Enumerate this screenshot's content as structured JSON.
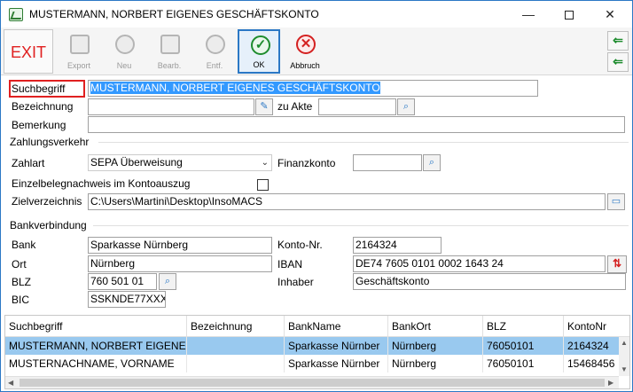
{
  "window": {
    "title": "MUSTERMANN, NORBERT EIGENES GESCHÄFTSKONTO",
    "minimize": "—",
    "close": "✕"
  },
  "toolbar": {
    "exit": "EXIT",
    "export": "Export",
    "neu": "Neu",
    "bearb": "Bearb.",
    "entf": "Entf.",
    "ok": "OK",
    "abbruch": "Abbruch",
    "ok_glyph": "✓",
    "cancel_glyph": "✕",
    "side_first": "⇐",
    "side_second": "⇐"
  },
  "form": {
    "suchbegriff_label": "Suchbegriff",
    "suchbegriff_value": "MUSTERMANN, NORBERT EIGENES GESCHÄFTSKONTO",
    "bezeichnung_label": "Bezeichnung",
    "bezeichnung_value": "",
    "zu_akte_label": "zu Akte",
    "zu_akte_value": "",
    "bemerkung_label": "Bemerkung",
    "bemerkung_value": ""
  },
  "zahlungsverkehr": {
    "title": "Zahlungsverkehr",
    "zahlart_label": "Zahlart",
    "zahlart_value": "SEPA Überweisung",
    "finanzkonto_label": "Finanzkonto",
    "finanzkonto_value": "",
    "einzelbeleg_label": "Einzelbelegnachweis im Kontoauszug",
    "einzelbeleg_checked": false,
    "zielverzeichnis_label": "Zielverzeichnis",
    "zielverzeichnis_value": "C:\\Users\\Martini\\Desktop\\InsoMACS"
  },
  "bankverbindung": {
    "title": "Bankverbindung",
    "bank_label": "Bank",
    "bank_value": "Sparkasse Nürnberg",
    "ort_label": "Ort",
    "ort_value": "Nürnberg",
    "blz_label": "BLZ",
    "blz_value": "760 501 01",
    "bic_label": "BIC",
    "bic_value": "SSKNDE77XXX",
    "kontonr_label": "Konto-Nr.",
    "kontonr_value": "2164324",
    "iban_label": "IBAN",
    "iban_value": "DE74 7605 0101 0002 1643 24",
    "inhaber_label": "Inhaber",
    "inhaber_value": "Geschäftskonto",
    "sort_glyph": "⇅"
  },
  "grid": {
    "columns": [
      "Suchbegriff",
      "Bezeichnung",
      "BankName",
      "BankOrt",
      "BLZ",
      "KontoNr"
    ],
    "rows": [
      [
        "MUSTERMANN, NORBERT EIGENE",
        "",
        "Sparkasse Nürnber",
        "Nürnberg",
        "76050101",
        "2164324"
      ],
      [
        "MUSTERNACHNAME, VORNAME",
        "",
        "Sparkasse Nürnber",
        "Nürnberg",
        "76050101",
        "15468456"
      ]
    ],
    "selected_row": 0
  }
}
